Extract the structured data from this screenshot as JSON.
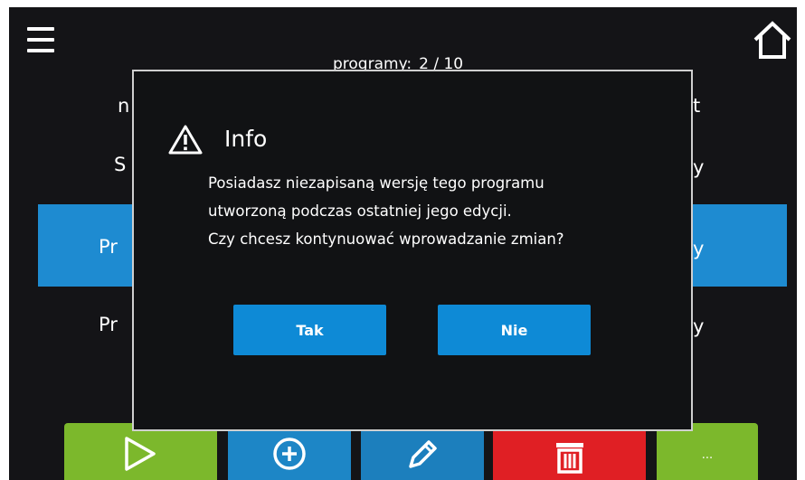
{
  "header": {
    "programs_label": "programy:",
    "programs_count": "2 / 10",
    "menu_icon": "hamburger-menu-icon",
    "home_icon": "home-icon"
  },
  "background_list": {
    "left_fragments": [
      "n",
      "S",
      "Pr",
      "Pr"
    ],
    "right_fragments": [
      "t",
      "y",
      "y",
      "y"
    ]
  },
  "toolbar": {
    "play_icon": "play-icon",
    "add_icon": "add-circle-icon",
    "edit_icon": "pencil-icon",
    "delete_icon": "trash-icon",
    "more_label": "..."
  },
  "dialog": {
    "icon": "warning-icon",
    "title": "Info",
    "message": [
      "Posiadasz niezapisaną wersję tego programu",
      "utworzoną podczas ostatniej jego edycji.",
      "Czy chcesz kontynuować wprowadzanie zmian?"
    ],
    "yes_label": "Tak",
    "no_label": "Nie"
  },
  "colors": {
    "screen_bg": "#141417",
    "selected_row": "#1e8bd1",
    "button_blue": "#0e8ad6",
    "play_green": "#7cb82c",
    "add_blue": "#1d86c6",
    "edit_blue": "#1c7fbd",
    "delete_red": "#e01f24",
    "more_green": "#7cb82c"
  }
}
